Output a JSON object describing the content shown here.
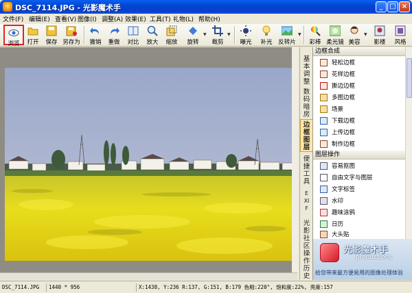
{
  "window": {
    "title": "DSC_7114.JPG - 光影魔术手",
    "minimize_glyph": "_",
    "maximize_glyph": "□",
    "close_glyph": "×"
  },
  "menu": [
    "文件(F)",
    "编辑(E)",
    "查看(V)",
    "图像(I)",
    "调整(A)",
    "效果(E)",
    "工具(T)",
    "礼物(L)",
    "帮助(H)"
  ],
  "toolbar": {
    "buttons": [
      {
        "label": "浏览",
        "icon": "eye-icon",
        "active": true
      },
      {
        "label": "打开",
        "icon": "folder-open-icon"
      },
      {
        "label": "保存",
        "icon": "floppy-disk-icon"
      },
      {
        "label": "另存为",
        "icon": "save-as-icon"
      },
      {
        "label": "撤销",
        "icon": "undo-icon"
      },
      {
        "label": "重做",
        "icon": "redo-icon"
      },
      {
        "label": "对比",
        "icon": "compare-icon"
      },
      {
        "label": "放大",
        "icon": "zoom-in-icon"
      },
      {
        "label": "缩放",
        "icon": "resize-icon"
      },
      {
        "label": "旋转",
        "icon": "rotate-icon"
      },
      {
        "label": "裁剪",
        "icon": "crop-icon"
      },
      {
        "label": "曝光",
        "icon": "exposure-icon"
      },
      {
        "label": "补光",
        "icon": "fill-light-icon"
      },
      {
        "label": "反转片",
        "icon": "film-icon"
      },
      {
        "label": "彩棒",
        "icon": "color-wand-icon"
      },
      {
        "label": "柔光镜",
        "icon": "soft-lens-icon"
      },
      {
        "label": "美容",
        "icon": "beauty-icon"
      },
      {
        "label": "影楼",
        "icon": "studio-icon"
      },
      {
        "label": "风格",
        "icon": "style-icon"
      }
    ]
  },
  "side_tabs": [
    {
      "label": "基本调整",
      "active": false
    },
    {
      "label": "数码暗房",
      "active": false
    },
    {
      "label": "边框图层",
      "active": true
    },
    {
      "label": "便捷工具",
      "active": false
    },
    {
      "label": "EXIF",
      "active": false
    },
    {
      "label": "光影社区",
      "active": false
    },
    {
      "label": "操作历史",
      "active": false
    }
  ],
  "panel": {
    "frames_title": "边框合成",
    "frames": [
      "轻松边框",
      "花样边框",
      "撕边边框",
      "多图边框",
      "场景",
      "下载边框",
      "上传边框",
      "制作边框"
    ],
    "layers_title": "图层操作",
    "layers": [
      "容易抠图",
      "自由文字与图层",
      "文字标签",
      "水印",
      "趣味涂鸦",
      "日历",
      "大头贴"
    ]
  },
  "promo": {
    "title": "光影魔术手",
    "subtitle": "productions",
    "tagline": "给您带来最方便易用的图像处理体验"
  },
  "statusbar": {
    "filename": "DSC_7114.JPG",
    "dimensions": "1440 * 956",
    "pixel_info": "X:1438, Y:236 R:137, G:151, B:179 色相:220°, 饱和度:22%, 亮度:157"
  },
  "colors": {
    "title_bar": "#0a4fe0",
    "sky": "#a6b1cf",
    "rapeseed": "#e8dc1a",
    "active_tab": "#ffe6a8",
    "active_tool_border": "#e22222"
  }
}
